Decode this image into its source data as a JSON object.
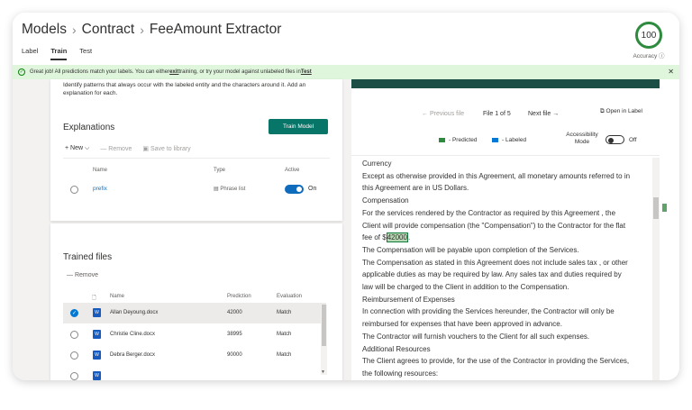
{
  "breadcrumb": [
    "Models",
    "Contract",
    "FeeAmount Extractor"
  ],
  "tabs": [
    "Label",
    "Train",
    "Test"
  ],
  "active_tab": "Train",
  "accuracy": {
    "value": "100",
    "label": "Accuracy"
  },
  "banner": {
    "text_before": "Great job! All predictions match your labels. You can either ",
    "exit_link": "exit",
    "text_middle": " training, or try your model against unlabeled files in ",
    "test_link": "Test"
  },
  "explanations": {
    "description": "Identify patterns that always occur with the labeled entity and the characters around it. Add an explanation for each.",
    "title": "Explanations",
    "train_button": "Train Model",
    "toolbar": {
      "new": "New",
      "remove": "Remove",
      "save": "Save to library"
    },
    "columns": {
      "name": "Name",
      "type": "Type",
      "active": "Active"
    },
    "row": {
      "name": "prefix",
      "type": "Phrase list",
      "active_label": "On"
    }
  },
  "trained_files": {
    "title": "Trained files",
    "remove": "Remove",
    "columns": {
      "name": "Name",
      "prediction": "Prediction",
      "evaluation": "Evaluation"
    },
    "rows": [
      {
        "name": "Allan Deyoung.docx",
        "prediction": "42000",
        "evaluation": "Match",
        "selected": true
      },
      {
        "name": "Christie Cline.docx",
        "prediction": "38995",
        "evaluation": "Match",
        "selected": false
      },
      {
        "name": "Debra Berger.docx",
        "prediction": "90000",
        "evaluation": "Match",
        "selected": false
      }
    ]
  },
  "viewer": {
    "prev": "Previous file",
    "page": "File 1 of 5",
    "next": "Next file",
    "open": "Open in Label",
    "legend_predicted": "- Predicted",
    "legend_labeled": "- Labeled",
    "accessibility": "Accessibility Mode",
    "accessibility_state": "Off",
    "colors": {
      "predicted": "#2e8b3e",
      "labeled": "#0078d4",
      "highlight": "#b8d8b4"
    },
    "doc": {
      "l1": "Currency",
      "l2": "Except as otherwise provided in this Agreement, all monetary amounts referred to in this Agreement are in US Dollars.",
      "l3": "Compensation",
      "l4a": "For the services rendered by the Contractor as required by this Agreement , the Client will provide compensation (the \"Compensation\") to the Contractor for the flat fee of $",
      "l4hl": "42000",
      "l4b": ".",
      "l5": "The Compensation will be payable upon completion of the Services.",
      "l6": "The Compensation as stated in this Agreement does not include sales tax , or other applicable duties as may be required by law. Any sales tax and duties required by law will be charged to the Client in addition to the Compensation.",
      "l7": "Reimbursement of Expenses",
      "l8": "In connection with providing the Services hereunder, the Contractor will only be reimbursed for expenses that have been approved in advance.",
      "l9": "The Contractor will furnish vouchers to the Client for all such expenses.",
      "l10": "Additional Resources",
      "l11": "The Client agrees to provide, for the use of the Contractor in providing the Services, the following resources:"
    }
  }
}
